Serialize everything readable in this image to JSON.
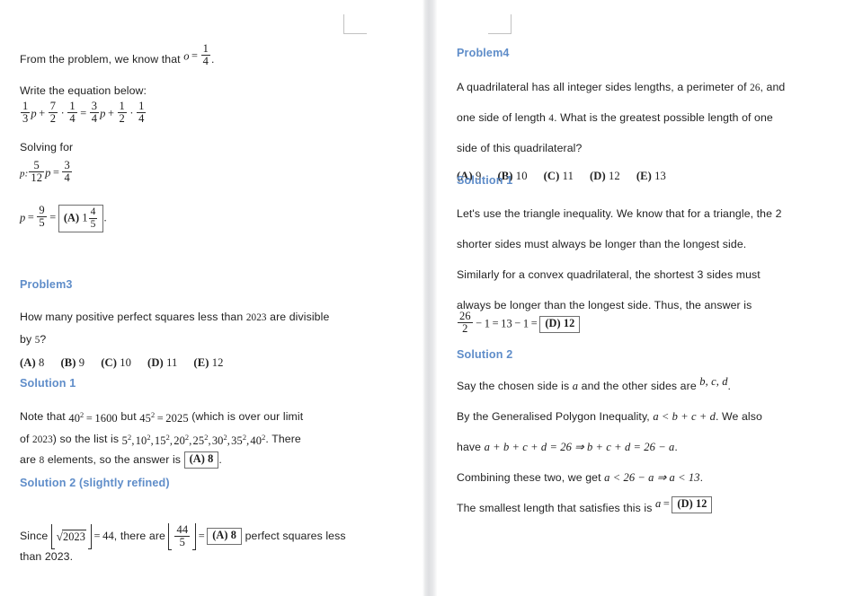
{
  "document": {
    "type": "math-competition-solutions-scan",
    "heading_color": "#5f8dc9",
    "text_color": "#222222",
    "background": "#ffffff"
  },
  "left_page": {
    "intro": {
      "text_before": "From the problem, we know that",
      "math": "o = 1/4",
      "math_var": "o",
      "math_eq": "=",
      "math_num": "1",
      "math_den": "4",
      "trailing": "."
    },
    "write_eq_label": "Write the equation below:",
    "equation": {
      "f1_num": "1",
      "f1_den": "3",
      "v1": "p",
      "plus1": "+",
      "f2_num": "7",
      "f2_den": "2",
      "dot1": "·",
      "f3_num": "1",
      "f3_den": "4",
      "eq": "=",
      "f4_num": "3",
      "f4_den": "4",
      "v2": "p",
      "plus2": "+",
      "f5_num": "1",
      "f5_den": "2",
      "dot2": "·",
      "f6_num": "1",
      "f6_den": "4"
    },
    "solving_for_label": "Solving for",
    "solve_line": {
      "var": "p:",
      "f1_num": "5",
      "f1_den": "12",
      "v": "p",
      "eq": "=",
      "f2_num": "3",
      "f2_den": "4"
    },
    "result_line": {
      "var": "p",
      "eq1": "=",
      "f_num": "9",
      "f_den": "5",
      "eq2": "=",
      "answer_label": "(A)",
      "answer_whole": "1",
      "answer_num": "4",
      "answer_den": "5",
      "period": "."
    },
    "problem3": {
      "heading": "Problem3",
      "statement_line1_a": "How many positive perfect squares less than",
      "statement_line1_num": "2023",
      "statement_line1_b": "are divisible",
      "statement_line2_a": "by",
      "statement_line2_num": "5",
      "statement_line2_b": "?",
      "choices": [
        {
          "label": "(A)",
          "value": "8"
        },
        {
          "label": "(B)",
          "value": "9"
        },
        {
          "label": "(C)",
          "value": "10"
        },
        {
          "label": "(D)",
          "value": "11"
        },
        {
          "label": "(E)",
          "value": "12"
        }
      ],
      "solution1": {
        "heading": "Solution 1",
        "l1_a": "Note that",
        "l1_m1_base": "40",
        "l1_m1_exp": "2",
        "l1_m1_eq": "=",
        "l1_m1_val": "1600",
        "l1_b": "but",
        "l1_m2_base": "45",
        "l1_m2_exp": "2",
        "l1_m2_eq": "=",
        "l1_m2_val": "2025",
        "l1_c": "(which is over our limit",
        "l2_a": "of",
        "l2_num": "2023",
        "l2_b": ") so the list is",
        "l2_list": [
          "5",
          "10",
          "15",
          "20",
          "25",
          "30",
          "35",
          "40"
        ],
        "l2_exp": "2",
        "l2_c": ". There",
        "l3_a": "are",
        "l3_num": "8",
        "l3_b": "elements, so the answer is",
        "l3_answer_label": "(A)",
        "l3_answer_value": "8",
        "l3_period": "."
      },
      "solution2": {
        "heading": "Solution 2 (slightly refined)",
        "l1_a": "Since",
        "sqrt_sym": "√",
        "sqrt_arg": "2023",
        "l1_eq": "=",
        "l1_val": "44",
        "l1_b": ", there are",
        "frac_num": "44",
        "frac_den": "5",
        "l1_eq2": "=",
        "answer_label": "(A)",
        "answer_value": "8",
        "l1_c": "perfect squares less",
        "l2": "than 2023."
      }
    }
  },
  "right_page": {
    "problem4": {
      "heading": "Problem4",
      "statement_line1_a": "A quadrilateral has all integer sides lengths, a perimeter of",
      "statement_line1_num": "26",
      "statement_line1_b": ", and",
      "statement_line2_a": "one side of length",
      "statement_line2_num": "4",
      "statement_line2_b": ". What is the greatest possible length of one",
      "statement_line3": "side of this quadrilateral?",
      "choices": [
        {
          "label": "(A)",
          "value": "9"
        },
        {
          "label": "(B)",
          "value": "10"
        },
        {
          "label": "(C)",
          "value": "11"
        },
        {
          "label": "(D)",
          "value": "12"
        },
        {
          "label": "(E)",
          "value": "13"
        }
      ],
      "solution1": {
        "heading": "Solution 1",
        "l1": "Let's use the triangle inequality. We know that for a triangle, the 2",
        "l2": "shorter sides must always be longer than the longest side.",
        "l3": "Similarly for a convex quadrilateral, the shortest 3 sides must",
        "l4": "always be longer than the longest side. Thus, the answer is",
        "eq": {
          "f_num": "26",
          "f_den": "2",
          "minus": "−",
          "one": "1",
          "eq1": "=",
          "thirteen": "13",
          "minus2": "−",
          "one2": "1",
          "eq2": "=",
          "answer_label": "(D)",
          "answer_value": "12"
        }
      },
      "solution2": {
        "heading": "Solution 2",
        "l1_a": "Say the chosen side is",
        "l1_m1": "a",
        "l1_b": "and the other sides are",
        "l1_m2": "b, c, d",
        "l1_c": ".",
        "l2_a": "By the Generalised Polygon Inequality,",
        "l2_m": "a < b + c + d",
        "l2_b": ". We also",
        "l3_a": "have",
        "l3_m": "a + b + c + d = 26 ⇒ b + c + d = 26 − a",
        "l3_b": ".",
        "l4_a": "Combining these two, we get",
        "l4_m": "a < 26 − a ⇒ a < 13",
        "l4_b": ".",
        "l5_a": "The smallest length that satisfies this is",
        "l5_m_var": "a",
        "l5_m_eq": "=",
        "l5_answer_label": "(D)",
        "l5_answer_value": "12"
      }
    }
  }
}
